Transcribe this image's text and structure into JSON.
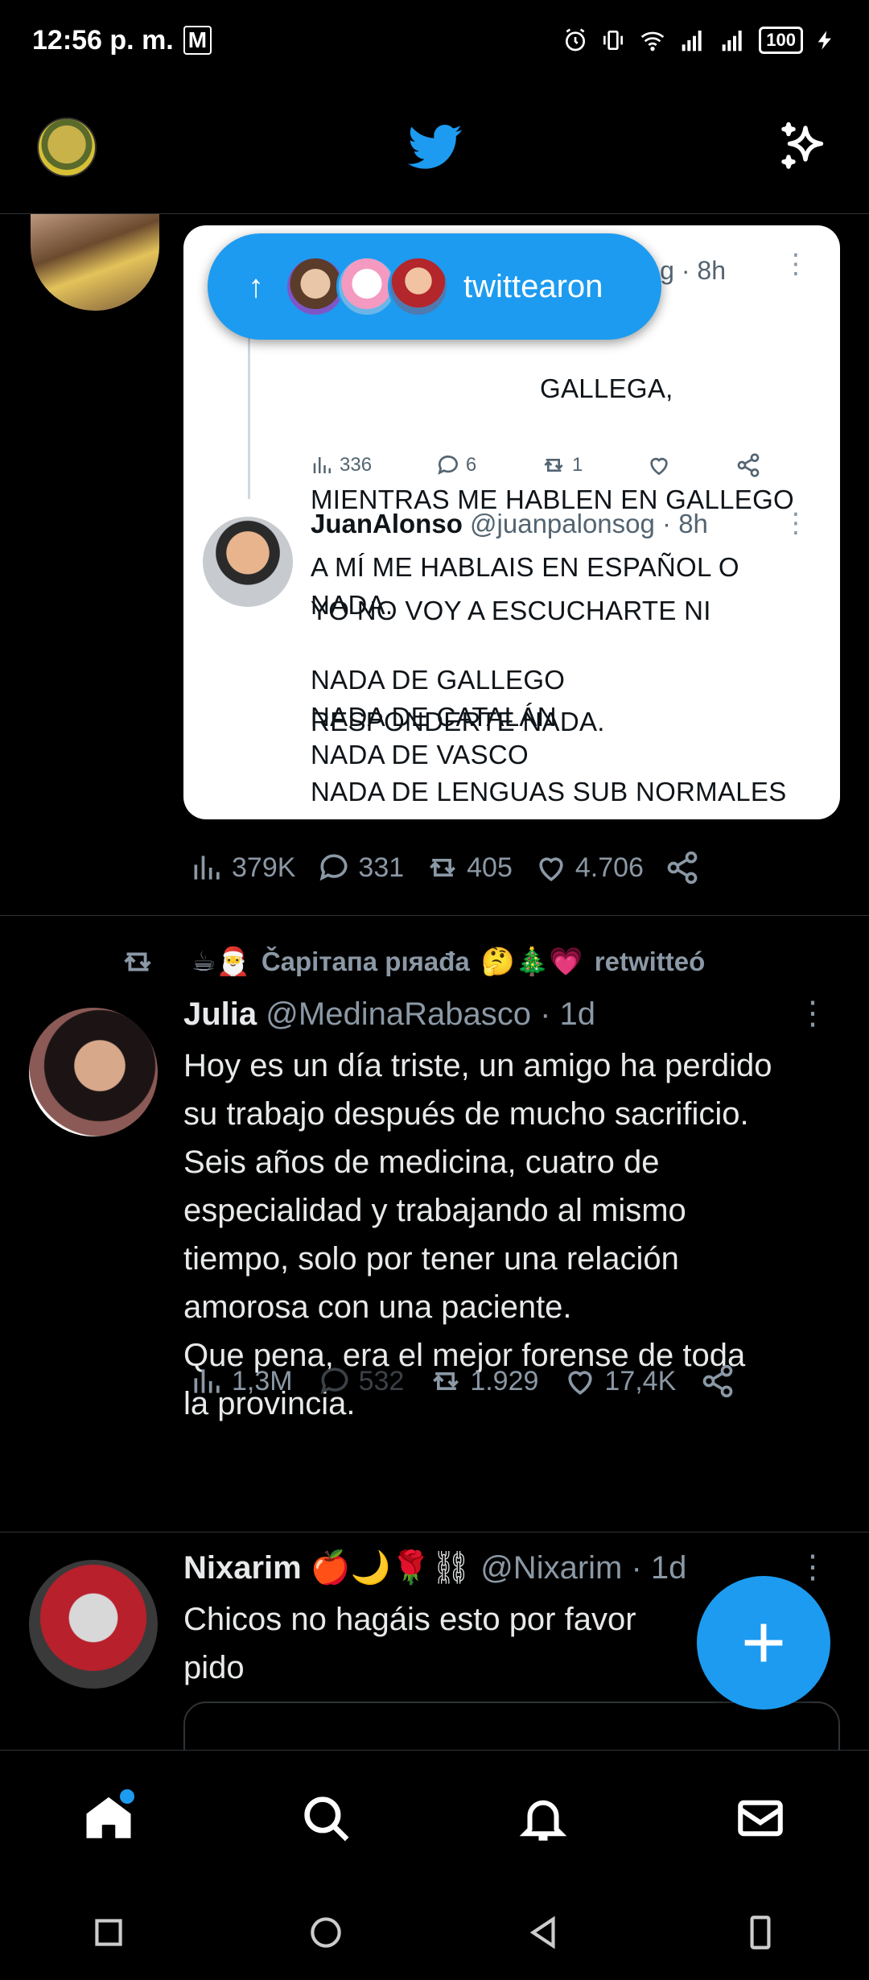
{
  "status_bar": {
    "time": "12:56 p. m.",
    "mail_glyph": "M",
    "battery": "100",
    "icons": [
      "alarm-icon",
      "vibrate-icon",
      "wifi-icon",
      "signal-icon",
      "signal-icon",
      "battery-icon",
      "charging-icon"
    ]
  },
  "header": {
    "logo": "twitter-bird-icon",
    "sparkle": "sparkle-icon"
  },
  "pill": {
    "arrow": "↑",
    "label": "twittearon"
  },
  "tweet1": {
    "quote": {
      "meta_top": "g · 8h",
      "text1_lines": [
        "GALLEGA,",
        "MIENTRAS ME HABLEN EN GALLEGO",
        "YO NO VOY A ESCUCHARTE NI",
        "RESPONDERTE NADA."
      ],
      "views": "336",
      "replies": "6",
      "retweets": "1",
      "name2": "JuanAlonso",
      "handle2": "@juanpalonsog · 8h",
      "text2": "A MÍ ME HABLAIS EN ESPAÑOL O\nNADA.\n\nNADA DE GALLEGO\nNADA DE CATALÁN\nNADA DE VASCO\nNADA DE LENGUAS SUB NORMALES"
    },
    "views": "379K",
    "replies": "331",
    "retweets": "405",
    "likes": "4.706"
  },
  "tweet2": {
    "retweeted_by_emoji_prefix": "☕🎅",
    "retweeted_by_name": "Čapiтaпa pıяađa",
    "retweeted_by_emoji_suffix": "🤔🎄💗",
    "retweeted_label": "retwitteó",
    "name": "Julia",
    "handle": "@MedinaRabasco · 1d",
    "text": "Hoy es un día triste, un amigo ha perdido\nsu trabajo después de mucho sacrificio.\nSeis años de medicina, cuatro de\nespecialidad y trabajando al mismo\ntiempo, solo por tener una relación\namorosa con una paciente.\nQue pena, era el mejor forense de toda\nla provincia.",
    "views": "1,3M",
    "replies": "532",
    "retweets": "1.929",
    "likes": "17,4K"
  },
  "tweet3": {
    "name": "Nixarim",
    "name_emoji": "🍎🌙🌹⛓",
    "handle": "@Nixarim · 1d",
    "text": "Chicos no hagáis esto por favor\npido"
  },
  "fab": {
    "label": "+"
  },
  "bottom_nav": [
    "home-icon",
    "search-icon",
    "notifications-icon",
    "messages-icon"
  ],
  "android_nav": [
    "recents-icon",
    "home-circle-icon",
    "back-icon",
    "rotate-icon"
  ],
  "colors": {
    "accent": "#1d9bf0",
    "bg": "#000000",
    "muted": "#8b98a5"
  }
}
